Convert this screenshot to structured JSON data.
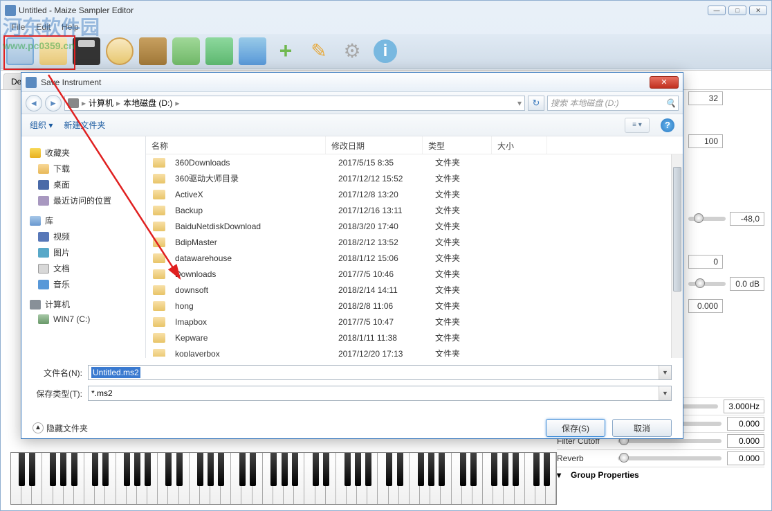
{
  "main": {
    "title": "Untitled - Maize Sampler Editor",
    "menus": [
      "File",
      "Edit",
      "Help"
    ],
    "tab": "De"
  },
  "watermark": {
    "name": "河东软件园",
    "url": "www.pc0359.cn"
  },
  "dialog": {
    "title": "Save Instrument",
    "path": {
      "root": "计算机",
      "drive": "本地磁盘 (D:)"
    },
    "search_placeholder": "搜索 本地磁盘 (D:)",
    "toolbar": {
      "organize": "组织",
      "new_folder": "新建文件夹"
    },
    "sidebar": {
      "fav": "收藏夹",
      "downloads": "下载",
      "desktop": "桌面",
      "recent": "最近访问的位置",
      "lib": "库",
      "video": "视频",
      "pic": "图片",
      "doc": "文档",
      "music": "音乐",
      "computer": "计算机",
      "win7": "WIN7 (C:)"
    },
    "columns": {
      "name": "名称",
      "date": "修改日期",
      "type": "类型",
      "size": "大小"
    },
    "files": [
      {
        "name": "360Downloads",
        "date": "2017/5/15 8:35",
        "type": "文件夹"
      },
      {
        "name": "360驱动大师目录",
        "date": "2017/12/12 15:52",
        "type": "文件夹"
      },
      {
        "name": "ActiveX",
        "date": "2017/12/8 13:20",
        "type": "文件夹"
      },
      {
        "name": "Backup",
        "date": "2017/12/16 13:11",
        "type": "文件夹"
      },
      {
        "name": "BaiduNetdiskDownload",
        "date": "2018/3/20 17:40",
        "type": "文件夹"
      },
      {
        "name": "BdipMaster",
        "date": "2018/2/12 13:52",
        "type": "文件夹"
      },
      {
        "name": "datawarehouse",
        "date": "2018/1/12 15:06",
        "type": "文件夹"
      },
      {
        "name": "Downloads",
        "date": "2017/7/5 10:46",
        "type": "文件夹"
      },
      {
        "name": "downsoft",
        "date": "2018/2/14 14:11",
        "type": "文件夹"
      },
      {
        "name": "hong",
        "date": "2018/2/8 11:06",
        "type": "文件夹"
      },
      {
        "name": "Imapbox",
        "date": "2017/7/5 10:47",
        "type": "文件夹"
      },
      {
        "name": "Kepware",
        "date": "2018/1/11 11:38",
        "type": "文件夹"
      },
      {
        "name": "koplayerbox",
        "date": "2017/12/20 17:13",
        "type": "文件夹"
      }
    ],
    "filename_label": "文件名(N):",
    "filename_value": "Untitled.ms2",
    "savetype_label": "保存类型(T):",
    "savetype_value": "*.ms2",
    "hide_folders": "隐藏文件夹",
    "save_btn": "保存(S)",
    "cancel_btn": "取消"
  },
  "right": {
    "v1": "32",
    "v2": "100",
    "v3": "-48,0",
    "v4": "0",
    "db": "0.0 dB",
    "p1": "0.000",
    "hz": "3.000Hz",
    "p2": "0.000",
    "filter": "Filter Cutoff",
    "filter_v": "0.000",
    "reverb": "Reverb",
    "reverb_v": "0.000",
    "group_header": "Group Properties"
  }
}
